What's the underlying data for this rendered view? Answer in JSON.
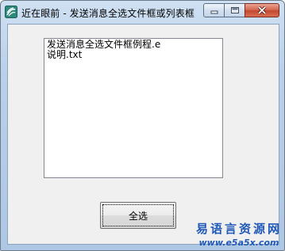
{
  "window": {
    "title": "近在眼前 - 发送消息全选文件框或列表框",
    "app_icon": "app-icon"
  },
  "caption_buttons": {
    "minimize_icon": "minimize-icon",
    "maximize_icon": "maximize-icon",
    "close_icon": "close-icon"
  },
  "listbox": {
    "items": [
      "发送消息全选文件框例程.e",
      "说明.txt"
    ]
  },
  "buttons": {
    "select_all": "全选"
  },
  "watermark": {
    "name": "易语言资源网",
    "url": "www.e5a5x.com"
  }
}
